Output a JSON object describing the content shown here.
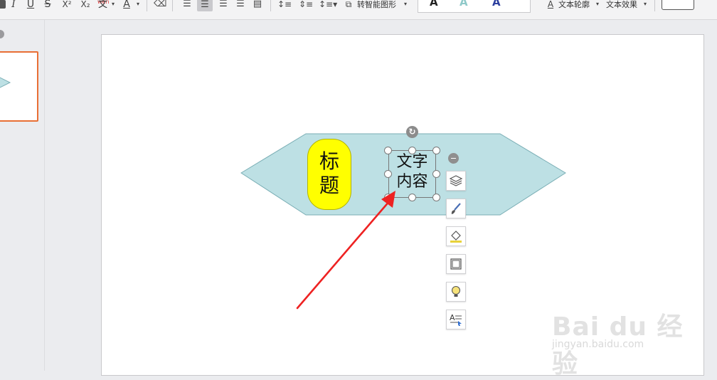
{
  "toolbar": {
    "smart_art_label": "转智能图形",
    "text_outline_label": "文本轮廓",
    "text_effect_label": "文本效果",
    "wen_label": "文",
    "wen_small": "wén"
  },
  "slide": {
    "title_chars": [
      "标",
      "题"
    ],
    "text_lines": [
      "文字",
      "内容"
    ]
  },
  "colors": {
    "hexagon_fill": "#bde0e4",
    "hexagon_stroke": "#7aaeb5",
    "pill_fill": "#ffff00",
    "thumb_border": "#e86f35",
    "arrow": "#ee2222"
  },
  "quick_tools": [
    "layers-icon",
    "brush-icon",
    "fill-bucket-icon",
    "frame-icon",
    "bulb-icon",
    "text-style-icon"
  ],
  "watermark": {
    "brand": "Bai du 经验",
    "url": "jingyan.baidu.com"
  }
}
